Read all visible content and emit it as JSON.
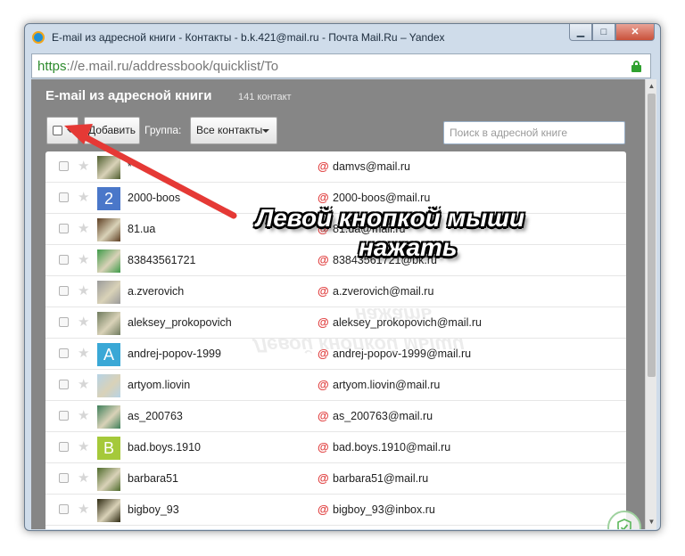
{
  "window": {
    "title": "E-mail из адресной книги - Контакты - b.k.421@mail.ru - Почта Mail.Ru – Yandex",
    "buttons": {
      "minimize": "▁",
      "maximize": "□",
      "close": "✕"
    }
  },
  "address_bar": {
    "url_scheme": "https",
    "url_rest": "://e.mail.ru/addressbook/quicklist/To"
  },
  "header": {
    "title": "E-mail из адресной книги",
    "count": "141 контакт"
  },
  "toolbar": {
    "add_label": "Добавить",
    "group_label": "Группа:",
    "group_selected": "Все контакты",
    "search_placeholder": "Поиск в адресной книге"
  },
  "contacts": [
    {
      "name": "**",
      "email": "damvs@mail.ru",
      "avatar": "photo",
      "avatar_color": "#4e5d2e"
    },
    {
      "name": "2000-boos",
      "email": "2000-boos@mail.ru",
      "avatar": "2",
      "avatar_color": "#4a77c9"
    },
    {
      "name": "81.ua",
      "email": "81.ua@mail.ru",
      "avatar": "photo",
      "avatar_color": "#5e3f23"
    },
    {
      "name": "83843561721",
      "email": "83843561721@bk.ru",
      "avatar": "photo",
      "avatar_color": "#3f9b49"
    },
    {
      "name": "a.zverovich",
      "email": "a.zverovich@mail.ru",
      "avatar": "photo",
      "avatar_color": "#9a9a9a"
    },
    {
      "name": "aleksey_prokopovich",
      "email": "aleksey_prokopovich@mail.ru",
      "avatar": "photo",
      "avatar_color": "#6f7b5e"
    },
    {
      "name": "andrej-popov-1999",
      "email": "andrej-popov-1999@mail.ru",
      "avatar": "A",
      "avatar_color": "#3aa8d6"
    },
    {
      "name": "artyom.liovin",
      "email": "artyom.liovin@mail.ru",
      "avatar": "photo",
      "avatar_color": "#b6d3e6"
    },
    {
      "name": "as_200763",
      "email": "as_200763@mail.ru",
      "avatar": "photo",
      "avatar_color": "#3f7f5a"
    },
    {
      "name": "bad.boys.1910",
      "email": "bad.boys.1910@mail.ru",
      "avatar": "B",
      "avatar_color": "#a5c93a"
    },
    {
      "name": "barbara51",
      "email": "barbara51@mail.ru",
      "avatar": "photo",
      "avatar_color": "#4f6b2c"
    },
    {
      "name": "bigboy_93",
      "email": "bigboy_93@inbox.ru",
      "avatar": "photo",
      "avatar_color": "#2e2a12"
    }
  ],
  "annotation": {
    "line1": "Левой кнопкой мыши",
    "line2": "нажать",
    "color": "#e53935"
  }
}
